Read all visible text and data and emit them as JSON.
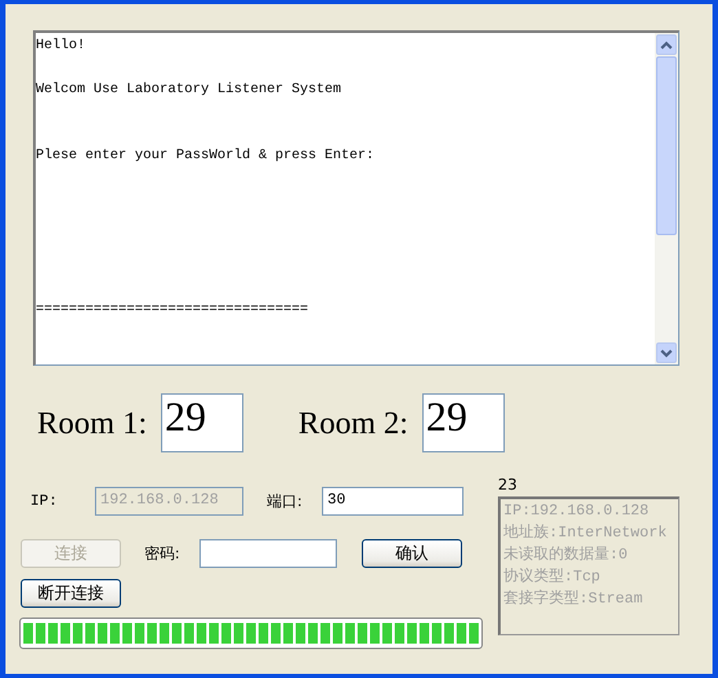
{
  "log": {
    "text": "Hello!\n\nWelcom Use Laboratory Listener System\n\n\nPlese enter your PassWorld & press Enter:\n\n\n\n\n\n\n================================="
  },
  "rooms": [
    {
      "label": "Room 1:",
      "value": "29"
    },
    {
      "label": "Room 2:",
      "value": "29"
    }
  ],
  "ip": {
    "label": "IP:",
    "value": "192.168.0.128",
    "disabled": true
  },
  "port": {
    "label": "端口:",
    "value": "30",
    "disabled": false
  },
  "connect_button": {
    "label": "连接",
    "disabled": true
  },
  "password": {
    "label": "密码:"
  },
  "confirm_button": {
    "label": "确认",
    "disabled": false
  },
  "disconnect_button": {
    "label": "断开连接",
    "disabled": false
  },
  "progress": {
    "level": 1
  },
  "info": {
    "count": "23",
    "lines": [
      "IP:192.168.0.128",
      "地址族:InterNetwork",
      "未读取的数据量:0",
      "协议类型:Tcp",
      "套接字类型:Stream"
    ]
  }
}
